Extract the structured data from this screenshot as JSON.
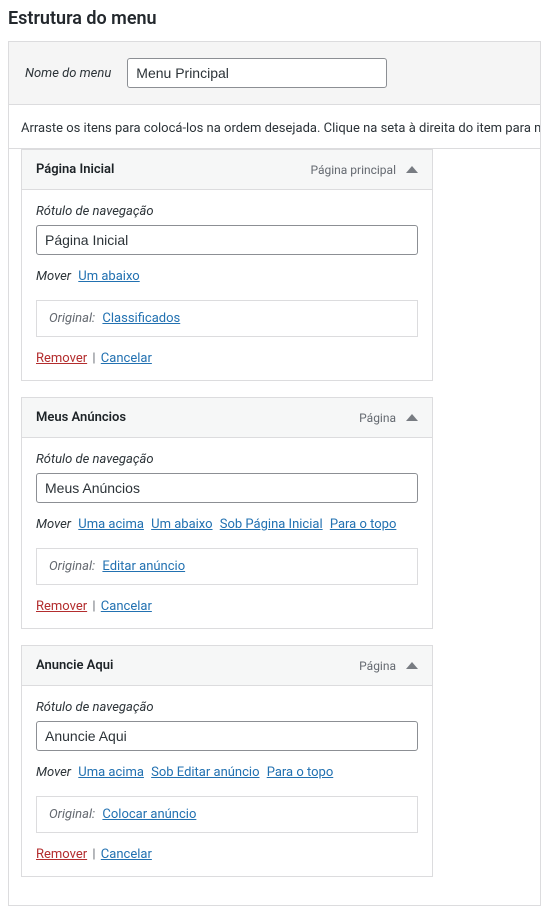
{
  "page_title": "Estrutura do menu",
  "menu_name": {
    "label": "Nome do menu",
    "value": "Menu Principal"
  },
  "instruction": "Arraste os itens para colocá-los na ordem desejada. Clique na seta à direita do item para mos",
  "labels": {
    "nav_label": "Rótulo de navegação",
    "move": "Mover",
    "original": "Original:",
    "remove": "Remover",
    "cancel": "Cancelar"
  },
  "items": [
    {
      "title": "Página Inicial",
      "type": "Página principal",
      "nav_value": "Página Inicial",
      "move_links": [
        "Um abaixo"
      ],
      "original": "Classificados"
    },
    {
      "title": "Meus Anúncios",
      "type": "Página",
      "nav_value": "Meus Anúncios",
      "move_links": [
        "Uma acima",
        "Um abaixo",
        "Sob Página Inicial",
        "Para o topo"
      ],
      "original": "Editar anúncio"
    },
    {
      "title": "Anuncie Aqui",
      "type": "Página",
      "nav_value": "Anuncie Aqui",
      "move_links": [
        "Uma acima",
        "Sob Editar anúncio",
        "Para o topo"
      ],
      "original": "Colocar anúncio"
    }
  ]
}
